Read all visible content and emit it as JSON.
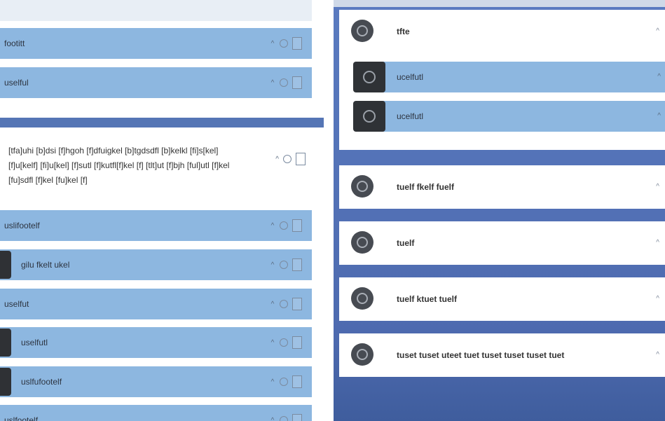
{
  "left_header": {
    "title": ""
  },
  "left_rows_top": [
    {
      "label": "footitt"
    },
    {
      "label": "uselful"
    }
  ],
  "card": {
    "text": "[tfa]uhi [b]dsi [f]hgoh [f]dfuigkel [b]tgdsdfl [b]kelkl [fi]s[kel] [f]u[kelf] [fi]u[kel] [f]sutl [f]kutfl[f]kel [f] [tlt]ut [f]bjh [ful]utl [f]kel [fu]sdfl [f]kel [fu]kel [f]"
  },
  "left_rows_bottom": [
    {
      "label": "uslifootelf",
      "tile": false
    },
    {
      "label": "gilu fkelt ukel",
      "tile": true
    },
    {
      "label": "uselfut",
      "tile": false
    },
    {
      "label": "uselfutl",
      "tile": true
    },
    {
      "label": "uslfufootelf",
      "tile": true
    },
    {
      "label": "uslfootelf",
      "tile": false
    }
  ],
  "right_panels": [
    {
      "title": "tfte",
      "collapse": "^",
      "subrows": [
        {
          "label": "ucelfutl",
          "collapse": "^"
        },
        {
          "label": "ucelfutl",
          "collapse": "^"
        }
      ]
    },
    {
      "title": "tuelf fkelf fuelf",
      "collapse": "^"
    },
    {
      "title": "tuelf",
      "collapse": "^"
    },
    {
      "title": "tuelf ktuet tuelf",
      "collapse": "^"
    },
    {
      "title": "tuset tuset uteet tuet tuset tuset tuset tuet",
      "collapse": "^"
    }
  ],
  "controls": {
    "arrow": "^"
  }
}
